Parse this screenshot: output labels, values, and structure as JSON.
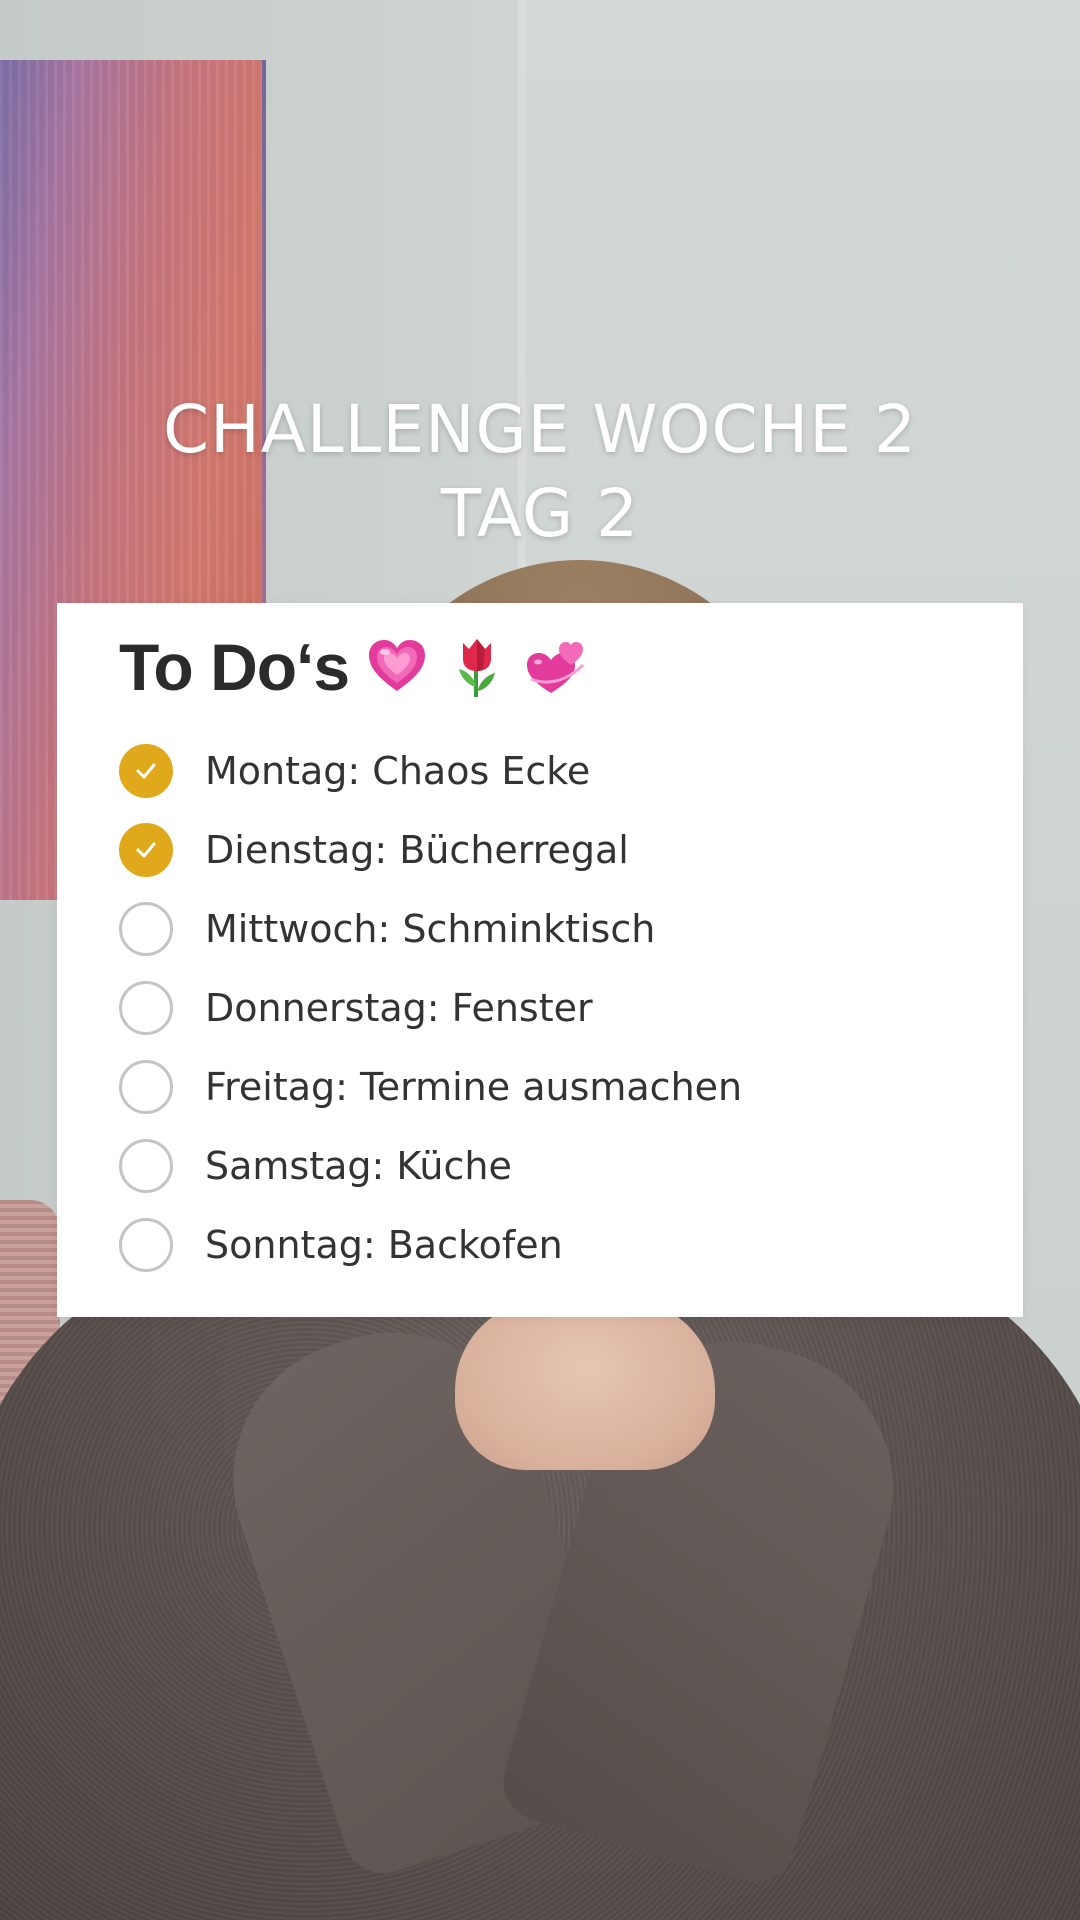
{
  "headline": {
    "line1": "CHALLENGE WOCHE 2",
    "line2": "TAG 2"
  },
  "card": {
    "title": "To Do‘s",
    "title_emojis": [
      "growing-heart-icon",
      "tulip-icon",
      "revolving-hearts-icon"
    ],
    "items": [
      {
        "label": "Montag: Chaos Ecke",
        "checked": true
      },
      {
        "label": "Dienstag: Bücherregal",
        "checked": true
      },
      {
        "label": "Mittwoch: Schminktisch",
        "checked": false
      },
      {
        "label": "Donnerstag: Fenster",
        "checked": false
      },
      {
        "label": "Freitag: Termine ausmachen",
        "checked": false
      },
      {
        "label": "Samstag: Küche",
        "checked": false
      },
      {
        "label": "Sonntag: Backofen",
        "checked": false
      }
    ]
  },
  "colors": {
    "check_done": "#e0a91b",
    "check_open_border": "#c4c4c4",
    "card_background": "#ffffff",
    "headline_text": "#ffffff"
  }
}
